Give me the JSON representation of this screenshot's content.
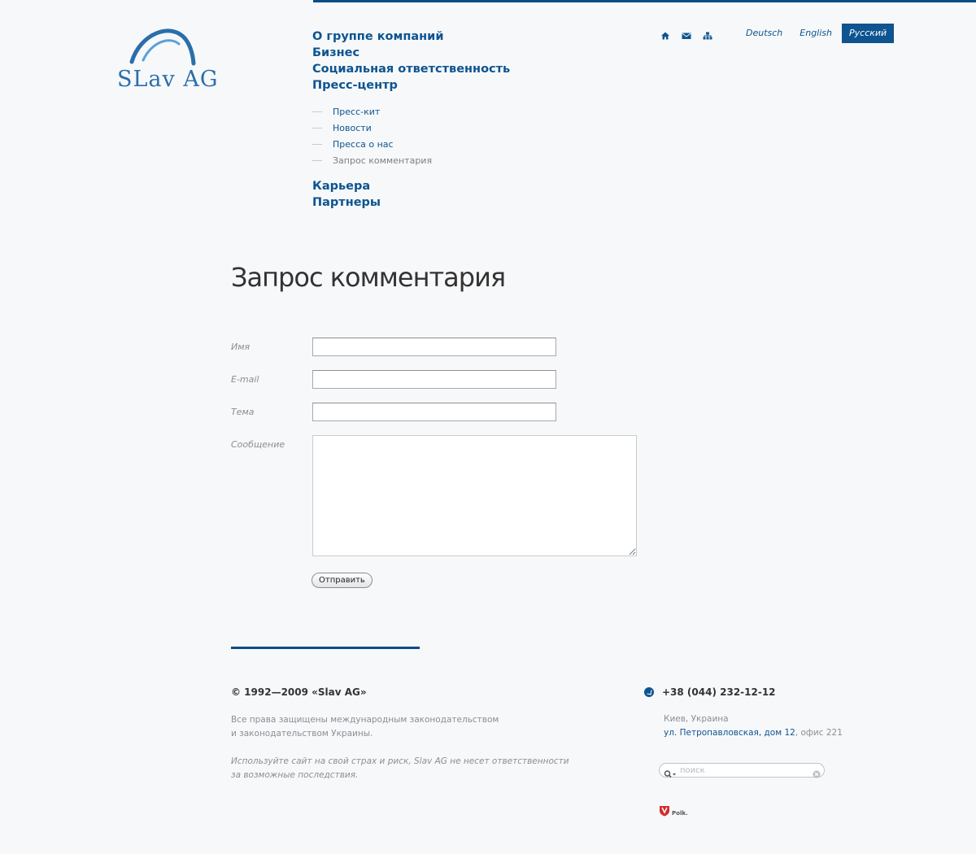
{
  "header": {
    "logo_text": "SLav AG",
    "nav": [
      {
        "label": "О группе компаний"
      },
      {
        "label": "Бизнес"
      },
      {
        "label": "Социальная ответственность"
      },
      {
        "label": "Пресс-центр"
      }
    ],
    "subnav": [
      {
        "label": "Пресс-кит"
      },
      {
        "label": "Новости"
      },
      {
        "label": "Пресса о нас"
      },
      {
        "label": "Запрос комментария"
      }
    ],
    "nav_after": [
      {
        "label": "Карьера"
      },
      {
        "label": "Партнеры"
      }
    ],
    "icons": [
      "home-icon",
      "mail-icon",
      "sitemap-icon"
    ],
    "languages": [
      {
        "label": "Deutsch"
      },
      {
        "label": "English"
      },
      {
        "label": "Русский",
        "active": true
      }
    ]
  },
  "page": {
    "title": "Запрос комментария"
  },
  "form": {
    "name_label": "Имя",
    "email_label": "E-mail",
    "subject_label": "Тема",
    "message_label": "Сообщение",
    "name_value": "",
    "email_value": "",
    "subject_value": "",
    "message_value": "",
    "submit_label": "Отправить"
  },
  "footer": {
    "copyright": "© 1992—2009 «Slav AG»",
    "rights_line1": "Все права защищены международным законодательством",
    "rights_line2": "и законодательством Украины.",
    "disclaimer_line1": "Используйте сайт на свой страх и риск, Slav AG не несет ответственности",
    "disclaimer_line2": "за возможные последствия.",
    "phone": "+38 (044) 232-12-12",
    "city": "Киев, Украина",
    "address_link": "ул. Петропавловская, дом 12",
    "address_rest": ", офис 221",
    "search_placeholder": "поиск",
    "polk_label": "Polk."
  },
  "colors": {
    "brand_blue": "#0d5490",
    "logo_blue": "#2a6eaa",
    "background": "#f7f8fa"
  }
}
